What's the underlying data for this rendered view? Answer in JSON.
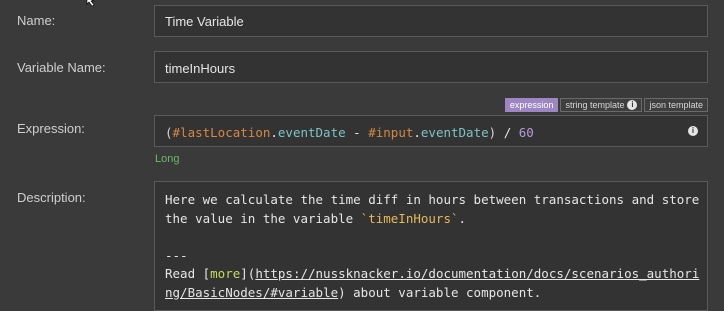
{
  "name": {
    "label": "Name:",
    "value": "Time Variable"
  },
  "variable_name": {
    "label": "Variable Name:",
    "value": "timeInHours"
  },
  "expression": {
    "label": "Expression:",
    "tabs": [
      {
        "label": "expression",
        "active": true
      },
      {
        "label": "string template",
        "active": false,
        "icon": "info-icon"
      },
      {
        "label": "json template",
        "active": false
      }
    ],
    "tokens": {
      "open": "(",
      "var1": "#lastLocation",
      "dot1": ".",
      "prop1": "eventDate",
      "minus": " - ",
      "var2": "#input",
      "dot2": ".",
      "prop2": "eventDate",
      "close": ")",
      "div": " / ",
      "num": "60"
    },
    "type_hint": "Long"
  },
  "description": {
    "label": "Description:",
    "line1": "Here we calculate the time diff in hours between transactions and store",
    "line2_pre": "the value in the variable ",
    "line2_code": "`timeInHours`",
    "line2_post": ".",
    "line4": "---",
    "line5_pre": "Read [",
    "line5_link": "more",
    "line5_mid": "](",
    "line5_url": "https://nussknacker.io/documentation/docs/scenarios_authori",
    "line6_url": "ng/BasicNodes/#variable",
    "line6_post": ") about variable component."
  },
  "colors": {
    "background": "#3a3a3a",
    "active_tab": "#9d86c2",
    "type_hint": "#69b86b"
  }
}
